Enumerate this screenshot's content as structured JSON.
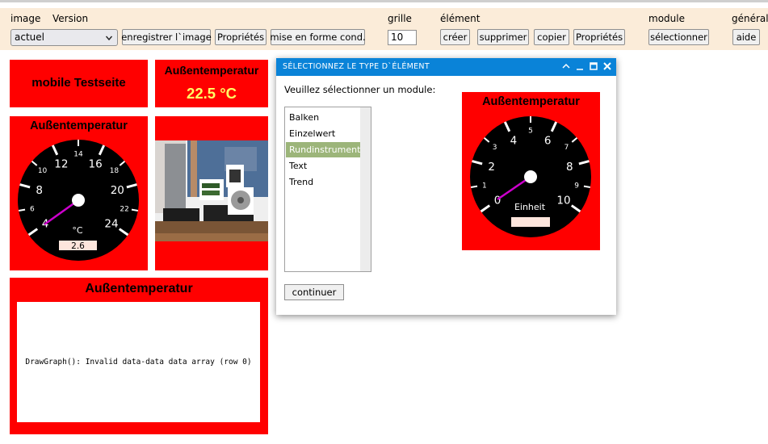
{
  "toolbar": {
    "groups": {
      "image": "image",
      "version": "Version",
      "grid": "grille",
      "element": "élément",
      "module": "module",
      "general": "général"
    },
    "version_select": "actuel",
    "save_image": "enregistrer l`image",
    "image_properties": "Propriétés",
    "conditional_format": "mise en forme cond.",
    "grid_value": "10",
    "create": "créer",
    "delete": "supprimer",
    "copy": "copier",
    "element_properties": "Propriétés",
    "select_module": "sélectionner",
    "help": "aide"
  },
  "canvas": {
    "title_panel": {
      "text": "mobile Testseite"
    },
    "value_panel": {
      "title": "Außentemperatur",
      "value": "22.5 °C",
      "value_color": "#ffff66"
    },
    "gauge_panel": {
      "title": "Außentemperatur",
      "unit": "°C",
      "value": "2.6",
      "major_ticks": [
        "4",
        "8",
        "12",
        "16",
        "20",
        "24"
      ],
      "minor_ticks": [
        "6",
        "10",
        "14",
        "18",
        "22"
      ]
    },
    "graph_panel": {
      "title": "Außentemperatur",
      "error": "DrawGraph(): Invalid data-data data array (row 0)"
    }
  },
  "dialog": {
    "title": "Sélectionnez le type d`élément",
    "prompt": "Veuillez sélectionner un module:",
    "modules": [
      "Balken",
      "Einzelwert",
      "Rundinstrument",
      "Text",
      "Trend"
    ],
    "selected_module": "Rundinstrument",
    "continue_label": "continuer",
    "preview": {
      "title": "Außentemperatur",
      "unit": "Einheit",
      "major_ticks": [
        "0",
        "2",
        "4",
        "6",
        "8",
        "10"
      ],
      "minor_ticks": [
        "1",
        "3",
        "5",
        "7",
        "9"
      ]
    }
  },
  "colors": {
    "panel_red": "#ff0000",
    "toolbar_bg": "#fbecd9",
    "dialog_titlebar": "#0a83d8",
    "list_selection": "#9cb57a",
    "gauge_needle": "#cc00cc"
  }
}
